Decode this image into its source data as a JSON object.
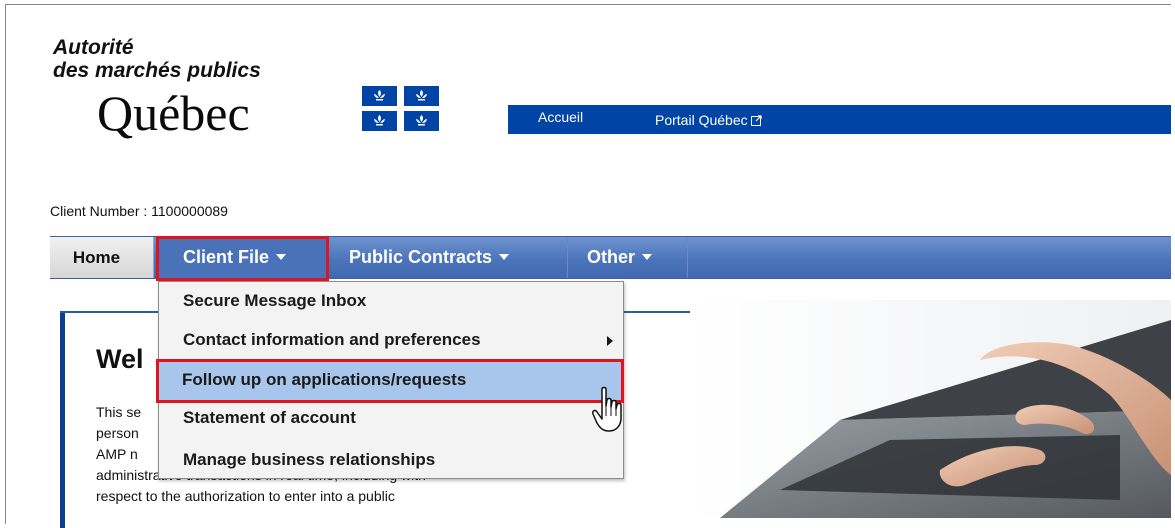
{
  "logo": {
    "line1": "Autorité",
    "line2": "des marchés publics",
    "quebec": "Québec"
  },
  "topnav": {
    "accueil": "Accueil",
    "portail": "Portail Québec"
  },
  "client_number": "Client Number : 1100000089",
  "menubar": {
    "home": "Home",
    "client_file": "Client File",
    "public_contracts": "Public Contracts",
    "other": "Other"
  },
  "dropdown": {
    "items": [
      "Secure Message Inbox",
      "Contact information and preferences",
      "Follow up on applications/requests",
      "Statement of account",
      "Manage business relationships"
    ]
  },
  "main": {
    "welcome": "Wel",
    "body_lines": [
      "This se",
      "person",
      "AMP n",
      "administrative transactions in real time, including with",
      "respect to the authorization to enter into a public"
    ]
  },
  "colors": {
    "brand_blue": "#0044a6",
    "menu_blue": "#4c74ba",
    "highlight_red": "#e0141e",
    "active_item_bg": "#a8c6ec"
  }
}
